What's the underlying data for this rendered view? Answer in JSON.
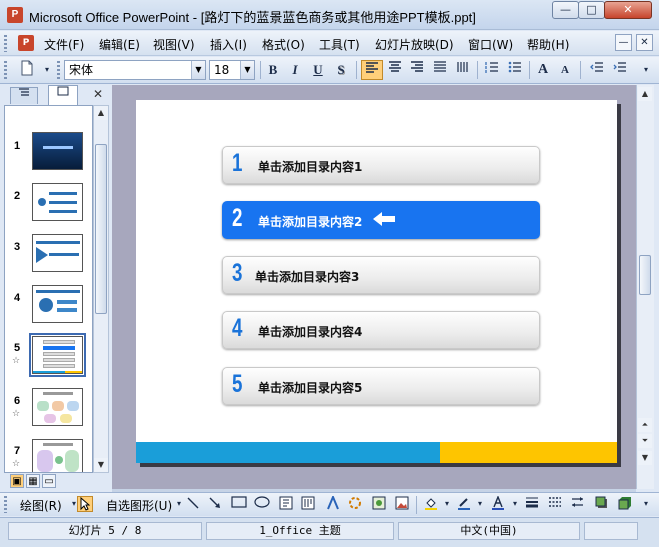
{
  "window": {
    "title": "Microsoft Office PowerPoint - [路灯下的蓝景蓝色商务或其他用途PPT模板.ppt]",
    "minimize_glyph": "—",
    "maximize_glyph": "□",
    "close_glyph": "✕",
    "app_icon": "P"
  },
  "menu": {
    "items": [
      "文件(F)",
      "编辑(E)",
      "视图(V)",
      "插入(I)",
      "格式(O)",
      "工具(T)",
      "幻灯片放映(D)",
      "窗口(W)",
      "帮助(H)"
    ],
    "mdi_min": "—",
    "mdi_close": "✕"
  },
  "toolbar": {
    "font_name": "宋体",
    "font_size": "18",
    "bold": "B",
    "italic": "I",
    "underline": "U",
    "shadow": "S",
    "increase_font": "A",
    "decrease_font": "A"
  },
  "outline_pane": {
    "close_glyph": "✕",
    "slides": [
      {
        "number": "1",
        "has_animation": false
      },
      {
        "number": "2",
        "has_animation": false
      },
      {
        "number": "3",
        "has_animation": false
      },
      {
        "number": "4",
        "has_animation": false
      },
      {
        "number": "5",
        "has_animation": true,
        "selected": true
      },
      {
        "number": "6",
        "has_animation": true
      },
      {
        "number": "7",
        "has_animation": true
      }
    ],
    "star_glyph": "☆"
  },
  "slide": {
    "items": [
      {
        "number": "1",
        "text": "单击添加目录内容1"
      },
      {
        "number": "2",
        "text": "单击添加目录内容2",
        "active": true
      },
      {
        "number": "3",
        "text": "单击添加目录内容3"
      },
      {
        "number": "4",
        "text": "单击添加目录内容4"
      },
      {
        "number": "5",
        "text": "单击添加目录内容5"
      }
    ],
    "colors": {
      "accent_blue": "#1874f0",
      "bar_blue": "#1a9ed9",
      "bar_yellow": "#fec500"
    }
  },
  "drawing_toolbar": {
    "draw_label": "绘图(R)",
    "autoshapes_label": "自选图形(U)"
  },
  "status": {
    "slide_info": "幻灯片 5 / 8",
    "design": "1_Office 主题",
    "language": "中文(中国)"
  }
}
